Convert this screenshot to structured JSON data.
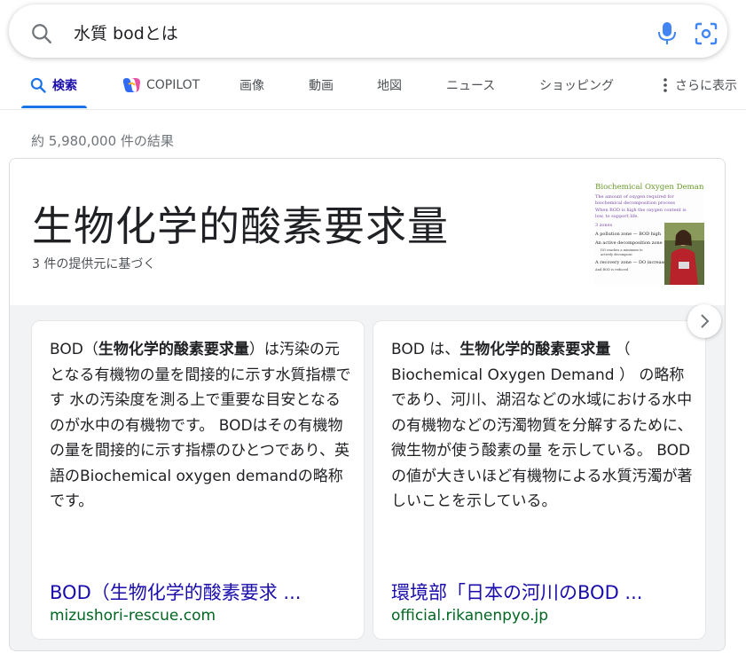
{
  "search": {
    "query": "水質 bodとは"
  },
  "tabs": [
    {
      "label": "検索"
    },
    {
      "label": "COPILOT"
    },
    {
      "label": "画像"
    },
    {
      "label": "動画"
    },
    {
      "label": "地図"
    },
    {
      "label": "ニュース"
    },
    {
      "label": "ショッピング"
    },
    {
      "label": "さらに表示"
    }
  ],
  "result_stats": "約 5,980,000 件の結果",
  "knowledge_panel": {
    "title": "生物化学的酸素要求量",
    "subtitle": "3 件の提供元に基づく",
    "thumbnail": {
      "heading": "Biochemical Oxygen Demand",
      "lines": [
        "The amount of oxygen required for",
        "biochemical decomposition process",
        "When BOD is high the oxygen content is",
        "low, to support life.",
        "3 zones",
        "A pollution zone — BOD high",
        "An active decomposition zone",
        "DO reaches a minimum to",
        "actively decompose",
        "A recovery zone — DO increases",
        "And BOD is reduced"
      ]
    },
    "sources": [
      {
        "text_pre": "BOD（",
        "text_bold": "生物化学的酸素要求量",
        "text_post": "）は汚染の元となる有機物の量を間接的に示す水質指標です 水の汚染度を測る上で重要な目安となるのが水中の有機物です。 BODはその有機物の量を間接的に示す指標のひとつであり、英語のBiochemical oxygen demandの略称です。",
        "title": "BOD（生物化学的酸素要求 ...",
        "domain": "mizushori-rescue.com"
      },
      {
        "text_pre": "BOD は、",
        "text_bold": "生物化学的酸素要求量",
        "text_post": " （ Biochemical Oxygen Demand ） の略称であり、河川、湖沼などの水域における水中の有機物などの汚濁物質を分解するために、微生物が使う酸素の量 を示している。 BOD の値が大きいほど有機物による水質汚濁が著しいことを示している。",
        "title": "環境部「日本の河川のBOD ...",
        "domain": "official.rikanenpyo.jp"
      }
    ]
  },
  "colors": {
    "link": "#1a0dab",
    "domain": "#006621",
    "active_tab_underline": "#1a73e8",
    "panel_background": "#f1f3f4"
  }
}
